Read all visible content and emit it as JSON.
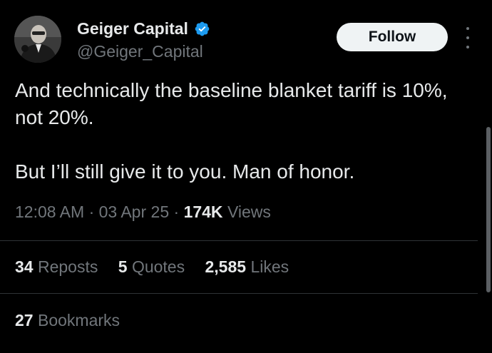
{
  "author": {
    "display_name": "Geiger Capital",
    "handle": "@Geiger_Capital",
    "verified_icon": "verified-badge-icon",
    "verified_color": "#1d9bf0"
  },
  "follow_button": {
    "label": "Follow"
  },
  "tweet": {
    "paragraph_1": "And technically the baseline blanket tariff is 10%, not 20%.",
    "paragraph_2": "But I’ll still give it to you. Man of honor."
  },
  "meta": {
    "time": "12:08 AM",
    "separator": "·",
    "date": "03 Apr 25",
    "views_count": "174K",
    "views_label": "Views"
  },
  "stats": {
    "reposts_count": "34",
    "reposts_label": "Reposts",
    "quotes_count": "5",
    "quotes_label": "Quotes",
    "likes_count": "2,585",
    "likes_label": "Likes",
    "bookmarks_count": "27",
    "bookmarks_label": "Bookmarks"
  },
  "colors": {
    "background": "#000000",
    "primary_text": "#e7e9ea",
    "secondary_text": "#71767b",
    "divider": "#2f3336"
  }
}
